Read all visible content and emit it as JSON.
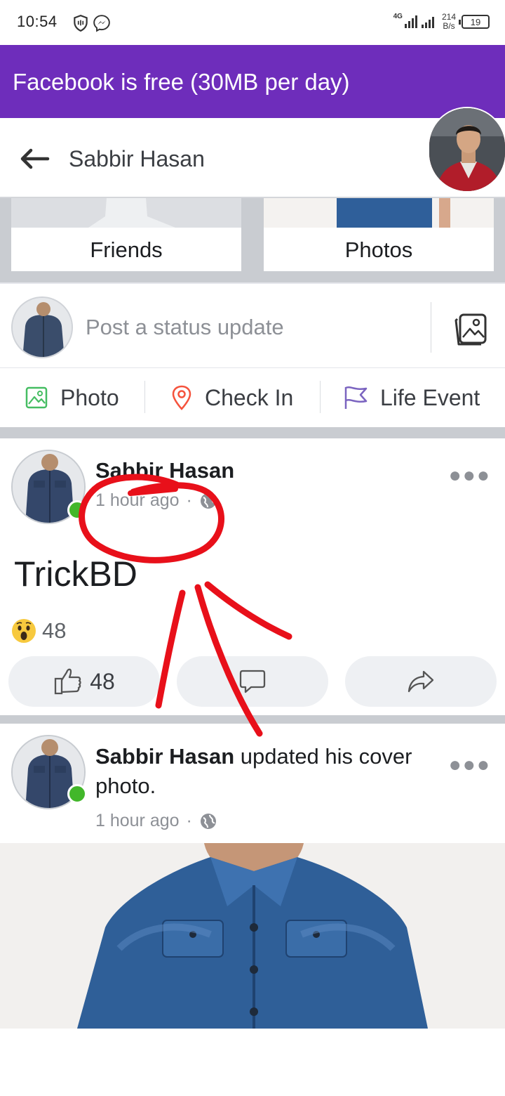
{
  "status_bar": {
    "time": "10:54",
    "network": "4G",
    "speed_value": "214",
    "speed_unit": "B/s",
    "battery": "19"
  },
  "banner": {
    "text": "Facebook is free (30MB per day)",
    "color": "#6e2dbb"
  },
  "header": {
    "title": "Sabbir Hasan"
  },
  "tiles": {
    "friends": "Friends",
    "photos": "Photos"
  },
  "composer": {
    "placeholder": "Post a status update"
  },
  "actions": {
    "photo": "Photo",
    "check_in": "Check In",
    "life_event": "Life Event"
  },
  "post1": {
    "author": "Sabbir Hasan",
    "time": "1 hour ago",
    "separator": "·",
    "text": "TrickBD",
    "reaction_count": "48",
    "like_count": "48"
  },
  "post2": {
    "author": "Sabbir Hasan",
    "action": " updated his cover photo.",
    "time": "1 hour ago",
    "separator": "·"
  },
  "icons": {
    "shield": "shield-icon",
    "messenger": "messenger-icon",
    "back": "back-arrow-icon",
    "gallery": "gallery-icon",
    "photo": "photo-icon",
    "checkin": "location-pin-icon",
    "life_event": "flag-icon",
    "globe": "globe-icon",
    "like": "thumbs-up-icon",
    "comment": "comment-icon",
    "share": "share-icon",
    "wow": "wow-reaction-icon"
  },
  "colors": {
    "accent": "#6e2dbb",
    "online": "#42b72a",
    "annotation": "#e8101a"
  }
}
